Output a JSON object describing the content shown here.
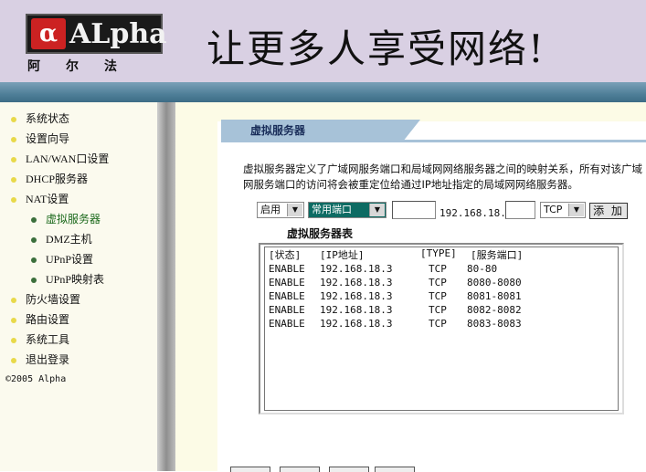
{
  "header": {
    "logo_mark": "α",
    "logo_text": "ALpha",
    "logo_cn": "阿尔法",
    "slogan": "让更多人享受网络!"
  },
  "sidebar": {
    "items": [
      {
        "label": "系统状态",
        "level": 1
      },
      {
        "label": "设置向导",
        "level": 1
      },
      {
        "label": "LAN/WAN口设置",
        "level": 1
      },
      {
        "label": "DHCP服务器",
        "level": 1
      },
      {
        "label": "NAT设置",
        "level": 1
      },
      {
        "label": "虚拟服务器",
        "level": 2,
        "active": true
      },
      {
        "label": "DMZ主机",
        "level": 2
      },
      {
        "label": "UPnP设置",
        "level": 2
      },
      {
        "label": "UPnP映射表",
        "level": 2
      },
      {
        "label": "防火墙设置",
        "level": 1
      },
      {
        "label": "路由设置",
        "level": 1
      },
      {
        "label": "系统工具",
        "level": 1
      },
      {
        "label": "退出登录",
        "level": 1
      }
    ],
    "copyright": "©2005 Alpha"
  },
  "main": {
    "title": "虚拟服务器",
    "description": "虚拟服务器定义了广域网服务端口和局域网网络服务器之间的映射关系，所有对该广域网服务端口的访问将会被重定位给通过IP地址指定的局域网网络服务器。",
    "form": {
      "enable_select": "启用",
      "port_type_select": "常用端口",
      "ip_prefix": "192.168.18.",
      "protocol_select": "TCP",
      "add_button": "添 加"
    },
    "table_title": "虚拟服务器表",
    "table": {
      "headers": [
        "[状态]",
        "[IP地址]",
        "[TYPE]",
        "[服务端口]"
      ],
      "rows": [
        [
          "ENABLE",
          "192.168.18.3",
          "TCP",
          "80-80"
        ],
        [
          "ENABLE",
          "192.168.18.3",
          "TCP",
          "8080-8080"
        ],
        [
          "ENABLE",
          "192.168.18.3",
          "TCP",
          "8081-8081"
        ],
        [
          "ENABLE",
          "192.168.18.3",
          "TCP",
          "8082-8082"
        ],
        [
          "ENABLE",
          "192.168.18.3",
          "TCP",
          "8083-8083"
        ]
      ]
    }
  },
  "colors": {
    "header_bg": "#d9d0e3",
    "header_bar": "#4f7f98",
    "sidebar_bg": "#fbfaee",
    "title_tab": "#a7c2d8",
    "highlight_select": "#0d6b63"
  }
}
